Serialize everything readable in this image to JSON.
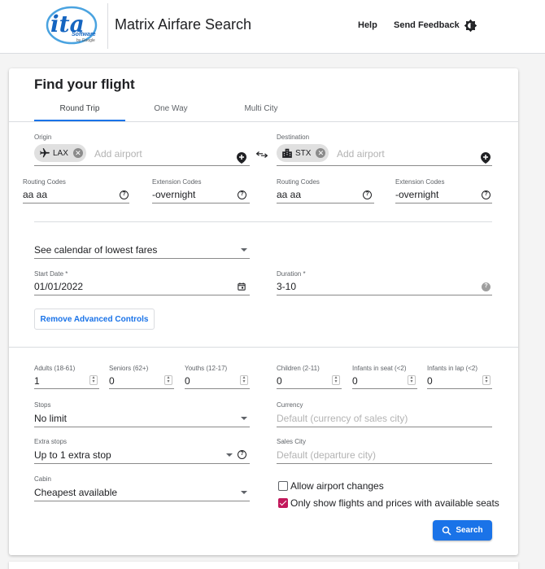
{
  "header": {
    "logo_text": "ita",
    "logo_sub": "Software",
    "logo_by": "by Google",
    "title": "Matrix Airfare Search",
    "help": "Help",
    "feedback": "Send Feedback"
  },
  "form": {
    "title": "Find your flight",
    "tabs": [
      "Round Trip",
      "One Way",
      "Multi City"
    ],
    "origin": {
      "label": "Origin",
      "chip": "LAX",
      "placeholder": "Add airport",
      "routing_label": "Routing Codes",
      "routing_value": "aa aa",
      "extension_label": "Extension Codes",
      "extension_value": "-overnight"
    },
    "destination": {
      "label": "Destination",
      "chip": "STX",
      "placeholder": "Add airport",
      "routing_label": "Routing Codes",
      "routing_value": "aa aa",
      "extension_label": "Extension Codes",
      "extension_value": "-overnight"
    },
    "calendar_select": "See calendar of lowest fares",
    "start_date_label": "Start Date *",
    "start_date_value": "01/01/2022",
    "duration_label": "Duration *",
    "duration_value": "3-10",
    "remove_advanced": "Remove Advanced Controls",
    "passengers": [
      {
        "label": "Adults (18-61)",
        "value": "1"
      },
      {
        "label": "Seniors (62+)",
        "value": "0"
      },
      {
        "label": "Youths (12-17)",
        "value": "0"
      },
      {
        "label": "Children (2-11)",
        "value": "0"
      },
      {
        "label": "Infants in seat (<2)",
        "value": "0"
      },
      {
        "label": "Infants in lap (<2)",
        "value": "0"
      }
    ],
    "stops_label": "Stops",
    "stops_value": "No limit",
    "currency_label": "Currency",
    "currency_placeholder": "Default (currency of sales city)",
    "extra_stops_label": "Extra stops",
    "extra_stops_value": "Up to 1 extra stop",
    "sales_city_label": "Sales City",
    "sales_city_placeholder": "Default (departure city)",
    "cabin_label": "Cabin",
    "cabin_value": "Cheapest available",
    "allow_airport_changes": "Allow airport changes",
    "only_available": "Only show flights and prices with available seats",
    "search": "Search"
  },
  "colors": {
    "accent": "#1a73e8",
    "checkbox_checked": "#c2185b",
    "logo_blue": "#1565c0"
  }
}
